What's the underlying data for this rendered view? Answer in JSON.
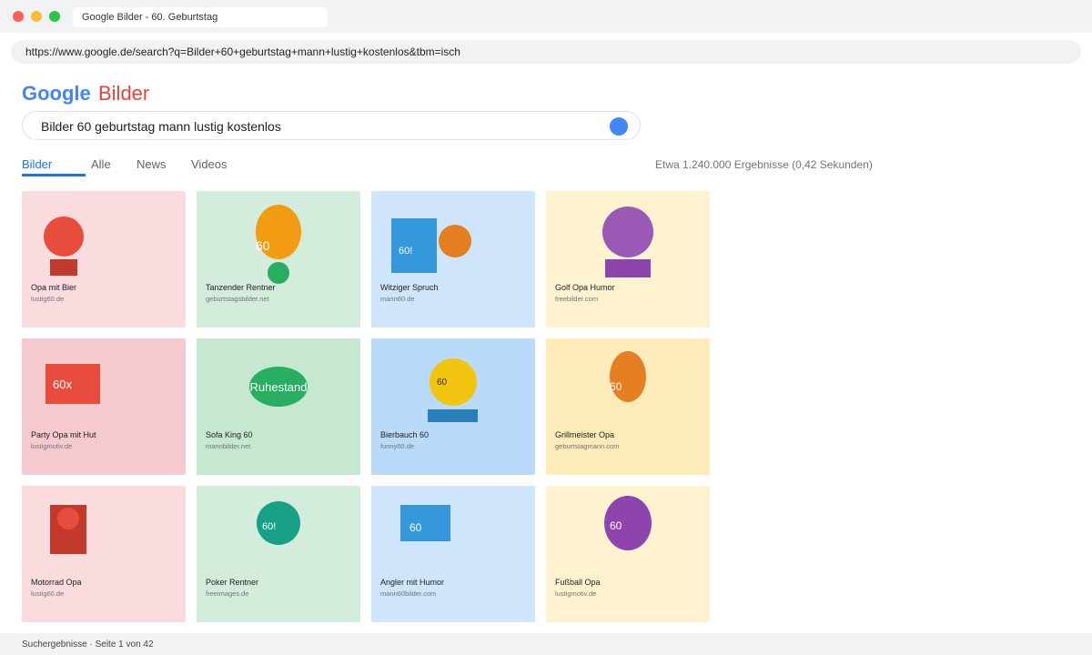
{
  "window": {
    "tab_title": "Google Bilder - 60. Geburtstag",
    "url": "https://www.google.de/search?q=Bilder+60+geburtstag+mann+lustig+kostenlos&tbm=isch"
  },
  "header": {
    "logo": "Google",
    "logo_sub": "Bilder",
    "query": "Bilder 60 geburtstag mann lustig kostenlos"
  },
  "tabs": [
    {
      "label": "Bilder",
      "active": true
    },
    {
      "label": "Alle"
    },
    {
      "label": "News"
    },
    {
      "label": "Videos"
    }
  ],
  "stats": "Etwa 1.240.000 Ergebnisse (0,42 Sekunden)",
  "results": [
    {
      "title": "Opa mit Bier",
      "source": "lustig60.de",
      "shape_text": ""
    },
    {
      "title": "Tanzender Rentner",
      "source": "geburtstagsbilder.net",
      "shape_text": "60"
    },
    {
      "title": "Witziger Spruch",
      "source": "mann60.de",
      "shape_text": "60!"
    },
    {
      "title": "Golf Opa Humor",
      "source": "freebilder.com",
      "shape_text": ""
    },
    {
      "title": "Party Opa mit Hut",
      "source": "lustigmotiv.de",
      "shape_text": "60x"
    },
    {
      "title": "Sofa King 60",
      "source": "mannbilder.net",
      "shape_text": "Ruhestand"
    },
    {
      "title": "Bierbauch 60",
      "source": "funny60.de",
      "shape_text": "60"
    },
    {
      "title": "Grillmeister Opa",
      "source": "geburtstagmann.com",
      "shape_text": "60"
    },
    {
      "title": "Motorrad Opa",
      "source": "lustig60.de",
      "shape_text": ""
    },
    {
      "title": "Poker Rentner",
      "source": "freeimages.de",
      "shape_text": "60!"
    },
    {
      "title": "Angler mit Humor",
      "source": "mann60bilder.com",
      "shape_text": "60"
    },
    {
      "title": "Fußball Opa",
      "source": "lustigmotiv.de",
      "shape_text": "60"
    }
  ],
  "footer": "Suchergebnisse · Seite 1 von 42",
  "colors": {
    "accent": "#1a73e8",
    "logo_blue": "#4285f4",
    "logo_red": "#ea4335"
  }
}
